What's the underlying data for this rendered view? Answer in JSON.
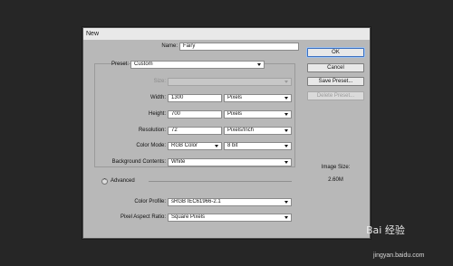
{
  "dialog": {
    "title": "New",
    "name_label": "Name:",
    "name_value": "Fairy",
    "preset_label": "Preset:",
    "preset_value": "Custom",
    "size_label": "Size:",
    "size_value": "",
    "width_label": "Width:",
    "width_value": "1300",
    "width_unit": "Pixels",
    "height_label": "Height:",
    "height_value": "700",
    "height_unit": "Pixels",
    "resolution_label": "Resolution:",
    "resolution_value": "72",
    "resolution_unit": "Pixels/Inch",
    "color_mode_label": "Color Mode:",
    "color_mode_value": "RGB Color",
    "bit_depth_value": "8 bit",
    "background_label": "Background Contents:",
    "background_value": "White",
    "advanced_label": "Advanced",
    "color_profile_label": "Color Profile:",
    "color_profile_value": "sRGB IEC61966-2.1",
    "pixel_aspect_label": "Pixel Aspect Ratio:",
    "pixel_aspect_value": "Square Pixels",
    "image_size_label": "Image Size:",
    "image_size_value": "2.60M"
  },
  "buttons": {
    "ok": "OK",
    "cancel": "Cancel",
    "save_preset": "Save Preset...",
    "delete_preset": "Delete Preset..."
  },
  "watermark": {
    "brand": "Bai 经验",
    "url": "jingyan.baidu.com"
  },
  "colors": {
    "background": "#262626",
    "dialog_body": "#b8b8b8",
    "titlebar": "#e9e9e9",
    "ok_border": "#3b6fbf"
  }
}
